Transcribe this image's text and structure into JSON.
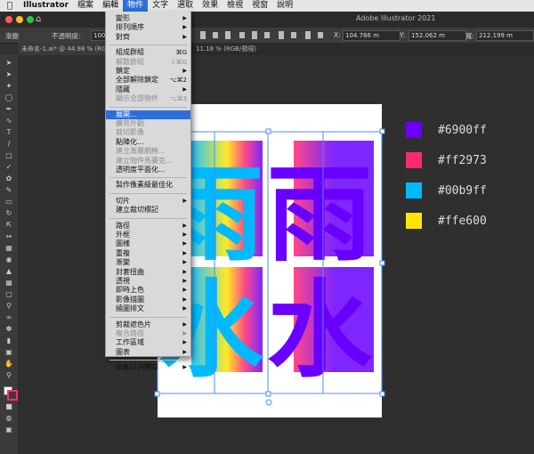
{
  "menubar": {
    "apple_icon": "apple-icon",
    "items": [
      "Illustrator",
      "檔案",
      "編輯",
      "物件",
      "文字",
      "選取",
      "效果",
      "檢視",
      "視窗",
      "說明"
    ],
    "active": "物件"
  },
  "titlebar": {
    "window_title": "Adobe Illustrator 2021"
  },
  "control_bar": {
    "mode_label": "漸變",
    "opacity_label": "不透明度:",
    "opacity_value": "100",
    "x_label": "X:",
    "x_value": "104.786 m",
    "y_label": "Y:",
    "y_value": "152.062 m",
    "w_label": "寬:",
    "w_value": "212.199 m"
  },
  "tabs": [
    {
      "label": "未命名-1.ai* @ 44.98 % (RGB/預視)",
      "active": true
    },
    {
      "label": "11.18 % (RGB/預視)",
      "active": false
    }
  ],
  "object_menu": {
    "items": [
      {
        "label": "變形",
        "arrow": true
      },
      {
        "label": "排列順序",
        "arrow": true
      },
      {
        "label": "對齊",
        "arrow": true
      },
      {
        "sep": true
      },
      {
        "label": "組成群組",
        "shortcut": "⌘G"
      },
      {
        "label": "解散群組",
        "shortcut": "⇧⌘G",
        "disabled": true
      },
      {
        "label": "鎖定",
        "arrow": true
      },
      {
        "label": "全部解除鎖定",
        "shortcut": "⌥⌘2"
      },
      {
        "label": "隱藏",
        "arrow": true
      },
      {
        "label": "顯示全部物件",
        "shortcut": "⌥⌘3",
        "disabled": true
      },
      {
        "sep": true
      },
      {
        "label": "展開...",
        "highlighted": true
      },
      {
        "label": "擴充外觀",
        "disabled": true
      },
      {
        "label": "裁切影像",
        "disabled": true
      },
      {
        "label": "點陣化..."
      },
      {
        "label": "建立漸層網格...",
        "disabled": true
      },
      {
        "label": "建立物件馬賽克...",
        "disabled": true
      },
      {
        "label": "透明度平面化..."
      },
      {
        "sep": true
      },
      {
        "label": "製作像素級最佳化"
      },
      {
        "sep": true
      },
      {
        "label": "切片",
        "arrow": true
      },
      {
        "label": "建立裁切標記"
      },
      {
        "sep": true
      },
      {
        "label": "路徑",
        "arrow": true
      },
      {
        "label": "外框",
        "arrow": true
      },
      {
        "label": "圖樣",
        "arrow": true
      },
      {
        "label": "重複",
        "arrow": true
      },
      {
        "label": "漸變",
        "arrow": true
      },
      {
        "label": "封套扭曲",
        "arrow": true
      },
      {
        "label": "透視",
        "arrow": true
      },
      {
        "label": "即時上色",
        "arrow": true
      },
      {
        "label": "影像描圖",
        "arrow": true
      },
      {
        "label": "繞圖排文",
        "arrow": true
      },
      {
        "sep": true
      },
      {
        "label": "剪裁遮色片",
        "arrow": true
      },
      {
        "label": "複合路徑",
        "arrow": true,
        "disabled": true
      },
      {
        "label": "工作區域",
        "arrow": true
      },
      {
        "label": "圖表",
        "arrow": true
      },
      {
        "sep": true
      },
      {
        "label": "收集以供轉存",
        "arrow": true
      }
    ]
  },
  "swatches": [
    {
      "color": "#6900ff",
      "label": "#6900ff"
    },
    {
      "color": "#ff2973",
      "label": "#ff2973"
    },
    {
      "color": "#00b9ff",
      "label": "#00b9ff"
    },
    {
      "color": "#ffe600",
      "label": "#ffe600"
    }
  ],
  "artwork": {
    "chars": [
      "雨",
      "雨",
      "水",
      "水"
    ],
    "gradient_colors": [
      "#00b9ff",
      "#ffe600",
      "#ff2973",
      "#6900ff"
    ]
  },
  "icons": {
    "sep_arrow": "▶"
  }
}
